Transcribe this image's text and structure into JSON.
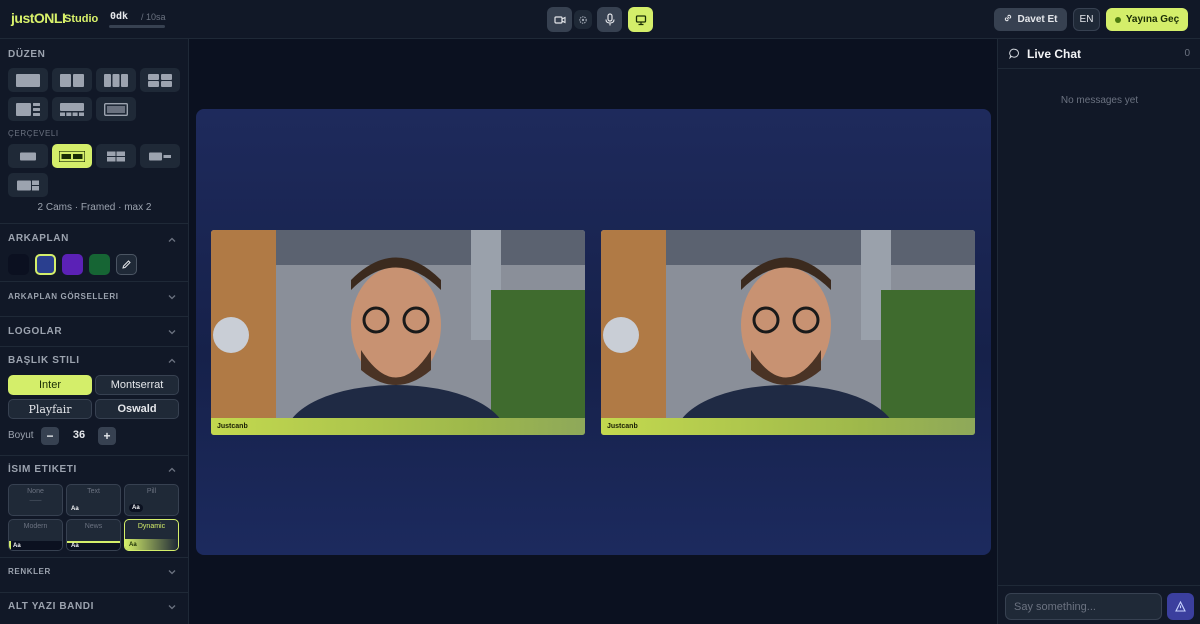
{
  "app": {
    "logo_text": "justONLI",
    "product": "Studio",
    "timer_current": "0dk",
    "timer_max": "/ 10sa"
  },
  "toolbar": {
    "camera_icon": "video-camera-icon",
    "settings_icon": "gear-icon",
    "mic_icon": "microphone-icon",
    "screen_icon": "monitor-icon",
    "invite_label": "Davet Et",
    "lang_label": "EN",
    "golive_label": "Yayına Geç"
  },
  "sidebar": {
    "layout_title": "DÜZEN",
    "framed_title": "ÇERÇEVELI",
    "framed_caption": "2 Cams · Framed · max 2",
    "background_title": "ARKAPLAN",
    "background_colors": [
      "#0b1020",
      "#2a3f8f",
      "#5b21b6",
      "#166534"
    ],
    "background_images_title": "ARKAPLAN GÖRSELLERI",
    "logos_title": "LOGOLAR",
    "title_style_title": "BAŞLIK STILI",
    "fonts": [
      "Inter",
      "Montserrat",
      "Playfair",
      "Oswald"
    ],
    "size_label": "Boyut",
    "size_minus": "−",
    "size_value": "36",
    "size_plus": "+",
    "name_tag_title": "İSIM ETIKETI",
    "name_tags": [
      {
        "name": "None",
        "sample": "——"
      },
      {
        "name": "Text",
        "sample": "Aa"
      },
      {
        "name": "Pill",
        "sample": "Aa"
      },
      {
        "name": "Modern",
        "sample": "Aa"
      },
      {
        "name": "News",
        "sample": "Aa"
      },
      {
        "name": "Dynamic",
        "sample": "Aa"
      }
    ],
    "colors_title": "RENKLER",
    "subtitle_band_title": "ALT YAZI BANDI"
  },
  "stage": {
    "cameras": [
      {
        "name": "Justcanb"
      },
      {
        "name": "Justcanb"
      }
    ]
  },
  "chat": {
    "title": "Live Chat",
    "count": "0",
    "empty_text": "No messages yet",
    "input_placeholder": "Say something..."
  }
}
